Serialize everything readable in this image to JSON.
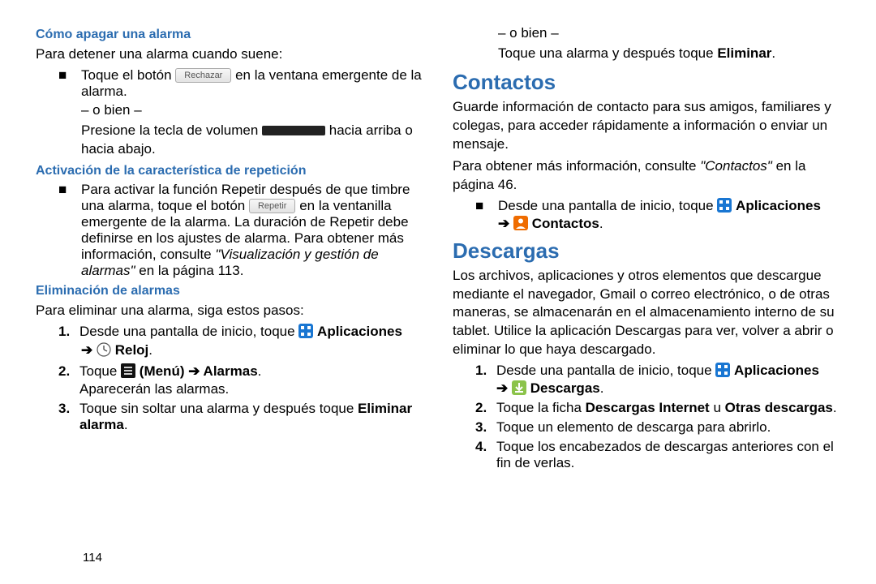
{
  "page_number": "114",
  "left": {
    "h1": "Cómo apagar una alarma",
    "p1": "Para detener una alarma cuando suene:",
    "bullet1_a": "Toque el botón ",
    "btn_rechazar": "Rechazar",
    "bullet1_b": " en la ventana emergente de la alarma.",
    "obien": "– o bien –",
    "bullet1_c": "Presione la tecla de volumen ",
    "bullet1_d": " hacia arriba o hacia abajo.",
    "h2": "Activación de la característica de repetición",
    "bullet2_a": "Para activar la función Repetir después de que timbre una alarma, toque el botón ",
    "btn_repetir": "Repetir",
    "bullet2_b": " en la ventanilla emergente de la alarma. La duración de Repetir debe definirse en los ajustes de alarma. Para obtener más información, consulte ",
    "bullet2_ref": "\"Visualización y gestión de alarmas\"",
    "bullet2_c": " en la página 113.",
    "h3": "Eliminación de alarmas",
    "p3": "Para eliminar una alarma, siga estos pasos:",
    "s1_num": "1.",
    "s1_a": "Desde una pantalla de inicio, toque ",
    "s1_apps": "Aplicaciones",
    "s1_arrow": "➔",
    "s1_reloj": "Reloj",
    "s2_num": "2.",
    "s2_a": "Toque ",
    "s2_menu": "(Menú) ➔ Alarmas",
    "s2_b": "Aparecerán las alarmas.",
    "s3_num": "3.",
    "s3_a": "Toque sin soltar una alarma y después toque ",
    "s3_b": "Eliminar alarma"
  },
  "right": {
    "obien": "– o bien –",
    "r1_a": "Toque una alarma y después toque ",
    "r1_b": "Eliminar",
    "h_contactos": "Contactos",
    "c_p1": "Guarde información de contacto para sus amigos, familiares y colegas, para acceder rápidamente a información o enviar un mensaje.",
    "c_p2a": "Para obtener más información, consulte ",
    "c_p2ref": "\"Contactos\"",
    "c_p2b": " en la página 46.",
    "c_b_a": "Desde una pantalla de inicio, toque ",
    "c_b_apps": "Aplicaciones",
    "c_b_arrow": "➔",
    "c_b_cont": "Contactos",
    "h_descargas": "Descargas",
    "d_p1": "Los archivos, aplicaciones y otros elementos que descargue mediante el navegador, Gmail o correo electrónico, o de otras maneras, se almacenarán en el almacenamiento interno de su tablet. Utilice la aplicación Descargas para ver, volver a abrir o eliminar lo que haya descargado.",
    "d1_num": "1.",
    "d1_a": "Desde una pantalla de inicio, toque ",
    "d1_apps": "Aplicaciones",
    "d1_arrow": "➔",
    "d1_desc": "Descargas",
    "d2_num": "2.",
    "d2_a": "Toque la ficha ",
    "d2_b": "Descargas Internet",
    "d2_c": " u ",
    "d2_d": "Otras descargas",
    "d3_num": "3.",
    "d3_a": "Toque un elemento de descarga para abrirlo.",
    "d4_num": "4.",
    "d4_a": "Toque los encabezados de descargas anteriores con el fin de verlas."
  }
}
